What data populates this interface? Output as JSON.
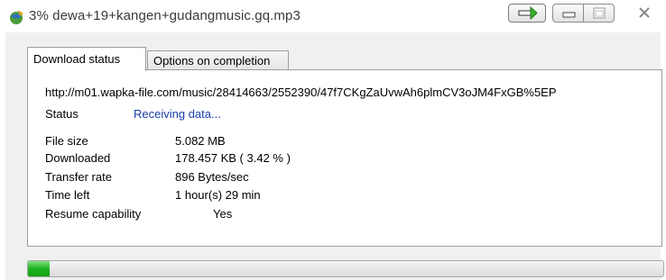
{
  "window": {
    "title": "3% dewa+19+kangen+gudangmusic.gq.mp3",
    "app_icon": "download-globe-icon",
    "buttons": [
      "arrow-right-icon",
      "minimize-icon",
      "maximize-icon",
      "close-icon"
    ]
  },
  "tabs": [
    {
      "label": "Download status",
      "active": true
    },
    {
      "label": "Options on completion",
      "active": false
    }
  ],
  "details": {
    "url": "http://m01.wapka-file.com/music/28414663/2552390/47f7CKgZaUvwAh6plmCV3oJM4FxGB%5EP",
    "status_label": "Status",
    "status_value": "Receiving data...",
    "rows": [
      {
        "label": "File size",
        "value": "5.082  MB"
      },
      {
        "label": "Downloaded",
        "value": "178.457  KB  ( 3.42 % )"
      },
      {
        "label": "Transfer rate",
        "value": "896  Bytes/sec"
      },
      {
        "label": "Time left",
        "value": "1 hour(s) 29 min"
      },
      {
        "label": "Resume capability",
        "value": "Yes"
      }
    ]
  },
  "progress": {
    "percent": 3.42,
    "fill_color": "#1fb21f"
  }
}
